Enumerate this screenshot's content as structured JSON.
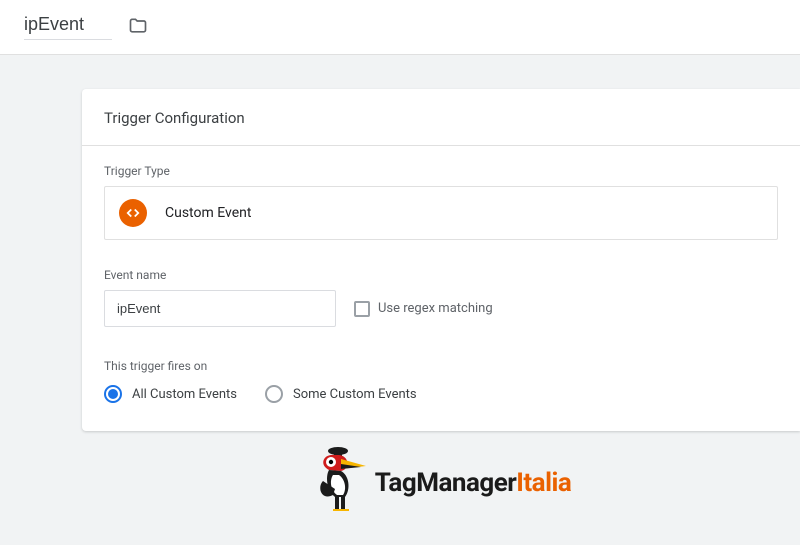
{
  "topbar": {
    "title_value": "ipEvent"
  },
  "card": {
    "header": "Trigger Configuration",
    "trigger_type_label": "Trigger Type",
    "trigger_type_value": "Custom Event",
    "event_name_label": "Event name",
    "event_name_value": "ipEvent",
    "regex_label": "Use regex matching",
    "fires_on_label": "This trigger fires on",
    "radio_options": {
      "all": "All Custom Events",
      "some": "Some Custom Events"
    }
  },
  "footer": {
    "brand_main": "TagManager",
    "brand_accent": "Italia"
  }
}
